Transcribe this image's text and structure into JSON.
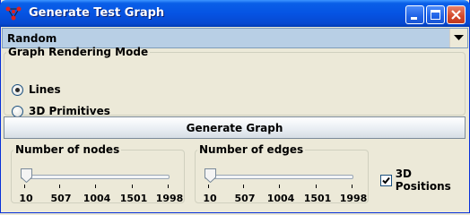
{
  "window": {
    "title": "Generate Test Graph"
  },
  "graph_type": {
    "selected": "Random"
  },
  "rendering_mode": {
    "legend": "Graph Rendering Mode",
    "options": [
      {
        "label": "Lines",
        "checked": true
      },
      {
        "label": "3D Primitives",
        "checked": false
      }
    ]
  },
  "generate_button": {
    "label": "Generate Graph"
  },
  "nodes_slider": {
    "legend": "Number of nodes",
    "min": 10,
    "max": 1998,
    "value": 10,
    "tick_labels": [
      "10",
      "507",
      "1004",
      "1501",
      "1998"
    ]
  },
  "edges_slider": {
    "legend": "Number of edges",
    "min": 10,
    "max": 1998,
    "value": 10,
    "tick_labels": [
      "10",
      "507",
      "1004",
      "1501",
      "1998"
    ]
  },
  "positions_checkbox": {
    "label": "3D Positions",
    "checked": true
  },
  "colors": {
    "titlebar": "#0554e3",
    "combo_bg": "#b8cfe5",
    "window_bg": "#ece9d8"
  }
}
